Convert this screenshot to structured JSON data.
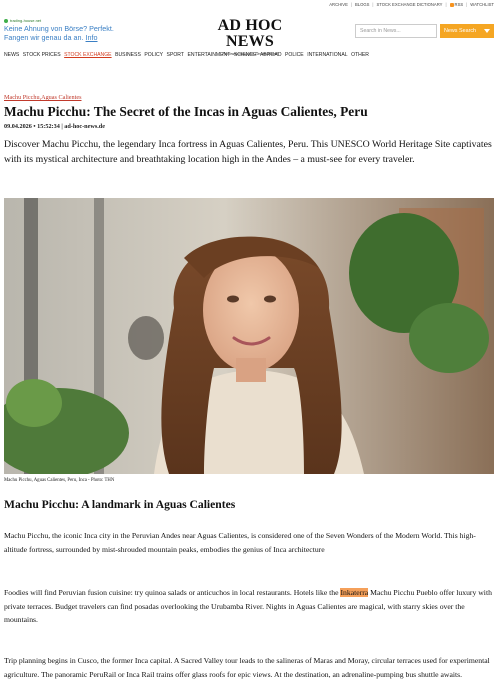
{
  "topbar": {
    "links": [
      "ARCHIVE",
      "BLOGS",
      "STOCK EXCHANGE DICTIONARY",
      "RSS",
      "WATCHLIST"
    ]
  },
  "ad": {
    "source": "trading-house.net",
    "line1": "Keine Ahnung von Börse? Perfekt.",
    "line2_prefix": "Fangen wir genau da an.",
    "line2_link": "Info"
  },
  "logo": {
    "title": "AD HOC NEWS",
    "subtitle": "Finanzzeitung für Deutschland"
  },
  "search": {
    "placeholder": "Search in News...",
    "button_label": "News Search",
    "button_icon": "chevron-down-icon"
  },
  "nav": {
    "items": [
      "NEWS",
      "STOCK PRICES",
      "STOCK EXCHANGE",
      "BUSINESS",
      "POLICY",
      "SPORT",
      "ENTERTAINMENT",
      "SCIENCE",
      "ABROAD",
      "POLICE",
      "INTERNATIONAL",
      "OTHER"
    ],
    "active_index": 2
  },
  "article": {
    "breadcrumb": "Machu Picchu,Aguas Calientes",
    "title": "Machu Picchu: The Secret of the Incas in Aguas Calientes, Peru",
    "dateline": "09.04.2026 • 15:52:34 | ad-hoc-news.de",
    "lead": "Discover Machu Picchu, the legendary Inca fortress in Aguas Calientes, Peru. This UNESCO World Heritage Site captivates with its mystical architecture and breathtaking location high in the Andes – a must-see for every traveler.",
    "image_caption": "Machu Picchu, Aguas Calientes, Peru, Inca - Photo: THN",
    "subheading": "Machu Picchu: A landmark in Aguas Calientes",
    "para1": "Machu Picchu, the iconic Inca city in the Peruvian Andes near Aguas Calientes, is considered one of the Seven Wonders of the Modern World. This high-altitude fortress, surrounded by mist-shrouded mountain peaks, embodies the genius of Inca architecture",
    "para2_before": "Foodies will find Peruvian fusion cuisine: try quinoa salads or anticuchos in local restaurants. Hotels like the ",
    "para2_highlight": "Inkaterra",
    "para2_after": " Machu Picchu Pueblo offer luxury with private terraces. Budget travelers can find posadas overlooking the Urubamba River. Nights in Aguas Calientes are magical, with starry skies over the mountains.",
    "para3": "Trip planning begins in Cusco, the former Inca capital. A Sacred Valley tour leads to the salineras of Maras and Moray, circular terraces used for experimental agriculture. The panoramic PeruRail or Inca Rail trains offer glass roofs for epic views. At the destination, an adrenaline-pumping bus shuttle awaits."
  },
  "colors": {
    "accent": "#f5a623",
    "active_nav": "#d23b1e",
    "breadcrumb": "#c0392b",
    "ad_text": "#3a7fc4",
    "highlight": "#f5a05a"
  }
}
